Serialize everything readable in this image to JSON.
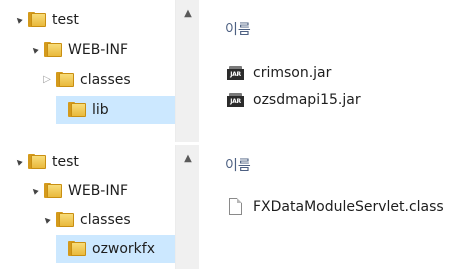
{
  "panels": [
    {
      "tree": [
        {
          "label": "test",
          "expander": "expanded",
          "selected": false
        },
        {
          "label": "WEB-INF",
          "expander": "expanded",
          "selected": false
        },
        {
          "label": "classes",
          "expander": "collapsed",
          "selected": false
        },
        {
          "label": "lib",
          "expander": "none",
          "selected": true
        }
      ],
      "column_header": "이름",
      "files": [
        {
          "name": "crimson.jar",
          "icon": "jar-file-icon"
        },
        {
          "name": "ozsdmapi15.jar",
          "icon": "jar-file-icon"
        }
      ]
    },
    {
      "tree": [
        {
          "label": "test",
          "expander": "expanded",
          "selected": false
        },
        {
          "label": "WEB-INF",
          "expander": "expanded",
          "selected": false
        },
        {
          "label": "classes",
          "expander": "expanded",
          "selected": false
        },
        {
          "label": "ozworkfx",
          "expander": "none",
          "selected": true
        }
      ],
      "column_header": "이름",
      "files": [
        {
          "name": "FXDataModuleServlet.class",
          "icon": "class-file-icon"
        }
      ]
    }
  ],
  "icons": {
    "expanded": "▲",
    "collapsed": "▷",
    "scroll_up": "▲",
    "jar_badge": "JAR"
  },
  "colors": {
    "selection": "#cce8ff",
    "folder": "#f1c75a",
    "header_text": "#4d6082"
  }
}
